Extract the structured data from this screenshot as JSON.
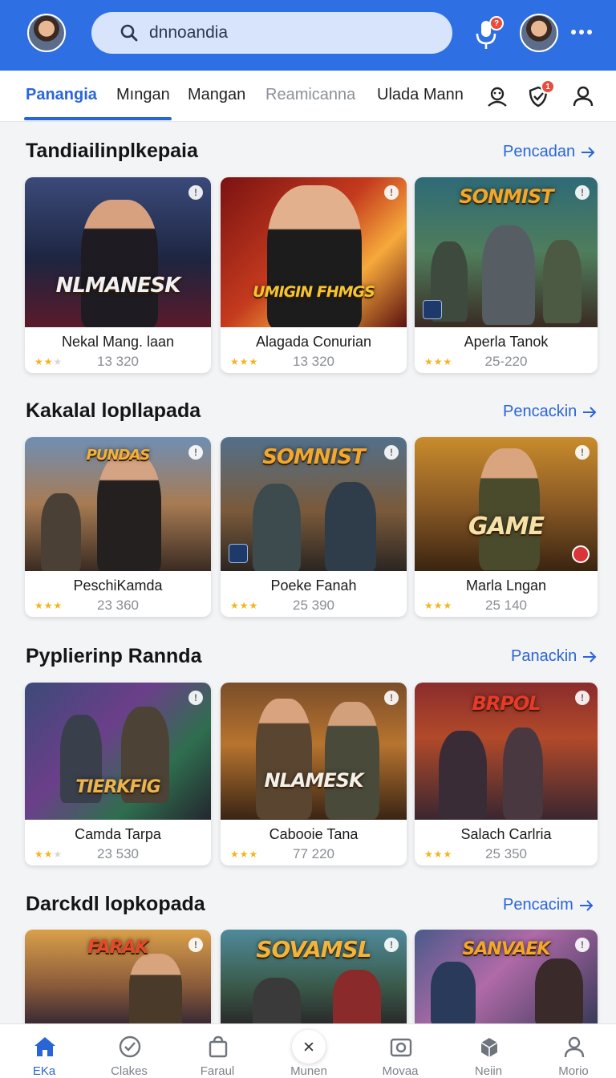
{
  "header": {
    "search_value": "dnnoandia",
    "mic_badge": "?",
    "colors": {
      "bar": "#2f6fe4",
      "accent": "#2a65d8"
    }
  },
  "tabs": [
    {
      "label": "Panangia",
      "active": true
    },
    {
      "label": "Mıngan"
    },
    {
      "label": "Mangan"
    },
    {
      "label": "Reamicanna",
      "muted": true
    },
    {
      "label": "Ulada Mann"
    }
  ],
  "tab_icons": {
    "notif_badge": "1"
  },
  "sections": [
    {
      "title": "Tandiailinplkepaia",
      "link": "Pencadan",
      "cards": [
        {
          "name": "Nekal Mang. laan",
          "count": "13 320",
          "stars": 2,
          "art": "NLMANESK"
        },
        {
          "name": "Alagada Conurian",
          "count": "13 320",
          "stars": 3,
          "art": "UMIGIN FHMGS"
        },
        {
          "name": "Aperla Tanok",
          "count": "25-220",
          "stars": 3,
          "art": "SONMIST"
        }
      ]
    },
    {
      "title": "Kakalal lopllapada",
      "link": "Pencackin",
      "cards": [
        {
          "name": "PeschiKamda",
          "count": "23 360",
          "stars": 3,
          "art": "PUNDAS"
        },
        {
          "name": "Poeke Fanah",
          "count": "25 390",
          "stars": 3,
          "art": "SOMNIST"
        },
        {
          "name": "Marla Lngan",
          "count": "25 140",
          "stars": 3,
          "art": "GAME"
        }
      ]
    },
    {
      "title": "Pyplierinp Rannda",
      "link": "Panackin",
      "cards": [
        {
          "name": "Camda Tarpa",
          "count": "23 530",
          "stars": 2,
          "art": "TIERKFIG"
        },
        {
          "name": "Cabooie Tana",
          "count": "77 220",
          "stars": 3,
          "art": "NLAMESK"
        },
        {
          "name": "Salach Carlria",
          "count": "25 350",
          "stars": 3,
          "art": "BRPOL"
        }
      ]
    },
    {
      "title": "Darckdl lopkopada",
      "link": "Pencacim",
      "cards": [
        {
          "art": "FARAK"
        },
        {
          "art": "SOVAMSL"
        },
        {
          "art": "SANVAEK"
        }
      ]
    }
  ],
  "bottom_nav": [
    {
      "label": "EKa",
      "icon": "home-icon",
      "active": true
    },
    {
      "label": "Clakes",
      "icon": "check-circle-icon"
    },
    {
      "label": "Faraul",
      "icon": "bag-icon"
    },
    {
      "label": "Munen",
      "icon": "close-icon"
    },
    {
      "label": "Movaa",
      "icon": "photo-icon"
    },
    {
      "label": "Neiin",
      "icon": "box-icon"
    },
    {
      "label": "Morio",
      "icon": "profile-icon"
    }
  ]
}
